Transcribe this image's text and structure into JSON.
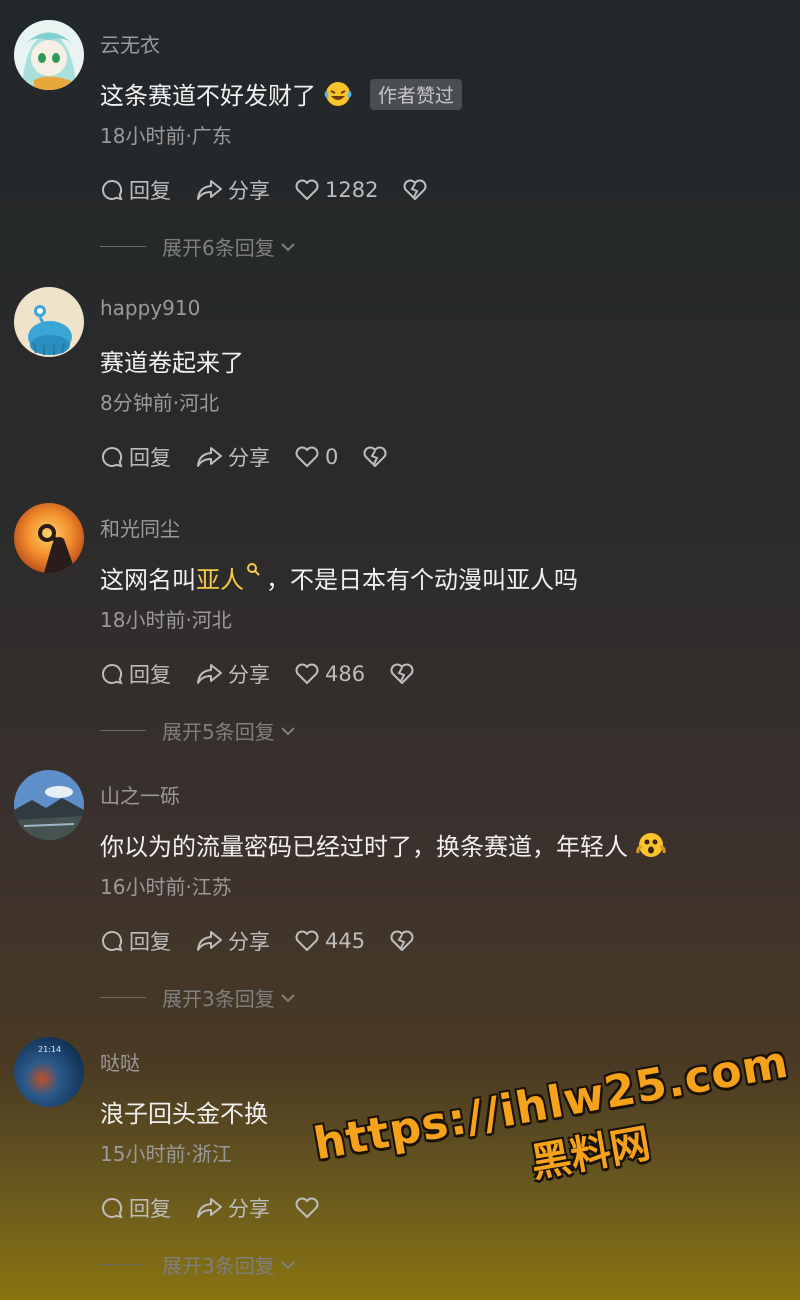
{
  "comments": [
    {
      "username": "云无衣",
      "text": "这条赛道不好发财了",
      "badge": "作者赞过",
      "meta": "18小时前·广东",
      "reply": "回复",
      "share": "分享",
      "likes": "1282",
      "expand": "展开6条回复"
    },
    {
      "username": "happy910",
      "text": "赛道卷起来了",
      "meta": "8分钟前·河北",
      "reply": "回复",
      "share": "分享",
      "likes": "0"
    },
    {
      "username": "和光同尘",
      "text_pre": "这网名叫",
      "text_highlight": "亚人",
      "text_post": "，不是日本有个动漫叫亚人吗",
      "meta": "18小时前·河北",
      "reply": "回复",
      "share": "分享",
      "likes": "486",
      "expand": "展开5条回复"
    },
    {
      "username": "山之一砾",
      "text": "你以为的流量密码已经过时了，换条赛道，年轻人",
      "meta": "16小时前·江苏",
      "reply": "回复",
      "share": "分享",
      "likes": "445",
      "expand": "展开3条回复"
    },
    {
      "username": "哒哒",
      "text": "浪子回头金不换",
      "meta": "15小时前·浙江",
      "reply": "回复",
      "share": "分享",
      "expand": "展开3条回复",
      "avatar_time": "21:14"
    }
  ],
  "watermark": {
    "url": "https://ihlw25.com",
    "name": "黑料网"
  },
  "colors": {
    "highlight": "#f4c84a",
    "watermark": "#f7a21b"
  }
}
